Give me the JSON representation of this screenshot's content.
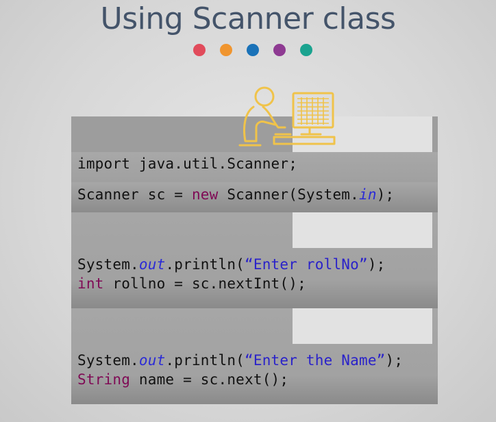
{
  "slide": {
    "title": "Using Scanner class"
  },
  "dots": [
    {
      "name": "dot-red",
      "color": "#e14b5b"
    },
    {
      "name": "dot-orange",
      "color": "#f0952f"
    },
    {
      "name": "dot-blue",
      "color": "#1a72b8"
    },
    {
      "name": "dot-purple",
      "color": "#8e3a92"
    },
    {
      "name": "dot-teal",
      "color": "#1aa38f"
    }
  ],
  "icon": "person-at-computer-icon",
  "colors": {
    "accent_icon": "#f0c34a",
    "keyword": "#7f0a55",
    "field": "#2b2bd6",
    "string": "#2a22c9"
  },
  "block1": {
    "line1": "import java.util.Scanner;",
    "line2": {
      "a": "Scanner sc = ",
      "kw": "new",
      "b": " Scanner(System.",
      "fld": "in",
      "c": ");"
    }
  },
  "block2": {
    "line1": {
      "a": "System.",
      "fld": "out",
      "b": ".println(",
      "str": "“Enter rollNo”",
      "c": ");"
    },
    "line2": {
      "kw": "int",
      "a": " rollno = sc.nextInt();"
    }
  },
  "block3": {
    "line1": {
      "a": "System.",
      "fld": "out",
      "b": ".println(",
      "str": "“Enter the Name”",
      "c": ");"
    },
    "line2": {
      "kw": "String",
      "a": " name = sc.next();"
    }
  }
}
